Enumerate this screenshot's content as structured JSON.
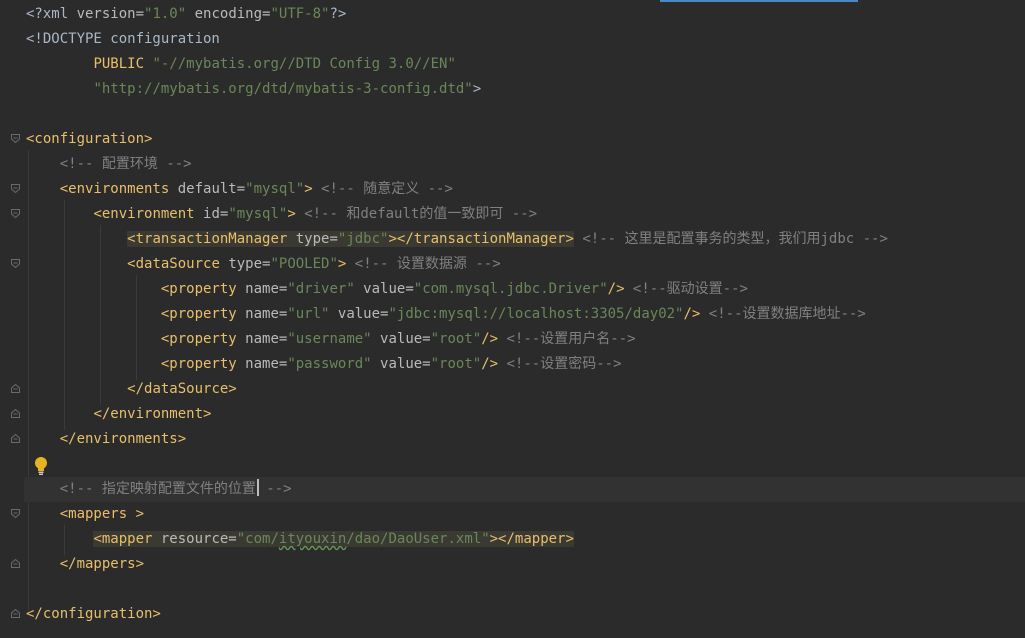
{
  "colors": {
    "background": "#2b2b2b",
    "tag": "#e8bf6a",
    "attribute": "#bababa",
    "value": "#6a8759",
    "comment": "#808080",
    "text": "#a9b7c6"
  },
  "icons": [
    "fold-marker-icon",
    "lightbulb-icon"
  ],
  "code": {
    "xml_decl_open": "<?xml ",
    "xml_decl_version": "version=",
    "xml_decl_version_val": "\"1.0\"",
    "xml_decl_encoding": " encoding=",
    "xml_decl_encoding_val": "\"UTF-8\"",
    "xml_decl_close": "?>",
    "doctype": "<!DOCTYPE configuration",
    "public_kw": "PUBLIC ",
    "public_id": "\"-//mybatis.org//DTD Config 3.0//EN\"",
    "system_id_open": "\"http://mybatis.org/dtd/mybatis-3-config.dtd\"",
    "doctype_close": ">",
    "configuration_open": "<configuration>",
    "comment_env": "<!-- 配置环境 -->",
    "environments_open": "<environments ",
    "attr_default": "default=",
    "val_mysql": "\"mysql\"",
    "gt": ">",
    "comment_define": " <!-- 随意定义 -->",
    "environment_open": "<environment ",
    "attr_id": "id=",
    "comment_same": " <!-- 和default的值一致即可 -->",
    "tm_open": "<transactionManager ",
    "attr_type": "type=",
    "val_jdbc": "\"jdbc\"",
    "tm_close": "></transactionManager>",
    "comment_tm": " <!-- 这里是配置事务的类型，我们用jdbc -->",
    "ds_open": "<dataSource ",
    "val_pooled": "\"POOLED\"",
    "comment_ds": " <!-- 设置数据源 -->",
    "prop_open": "<property ",
    "attr_name": "name=",
    "attr_value": " value=",
    "self_close": "/>",
    "val_driver": "\"driver\"",
    "val_driver_class": "\"com.mysql.jdbc.Driver\"",
    "comment_driver": " <!--驱动设置-->",
    "val_url": "\"url\"",
    "val_url_value": "\"jdbc:mysql://localhost:3305/day02\"",
    "comment_url": " <!--设置数据库地址-->",
    "val_username": "\"username\"",
    "val_root": "\"root\"",
    "comment_username": " <!--设置用户名-->",
    "val_password": "\"password\"",
    "comment_password": " <!--设置密码-->",
    "ds_close": "</dataSource>",
    "environment_close": "</environment>",
    "environments_close": "</environments>",
    "comment_mapper_a": "<!-- 指定映射配置文件的位置",
    "comment_mapper_b": " -->",
    "mappers_open": "<mappers >",
    "mapper_open": "<mapper ",
    "attr_resource": "resource=",
    "val_res_a": "\"com/",
    "val_res_u": "ityouxin",
    "val_res_b": "/dao/DaoUser.xml\"",
    "mapper_close": "></mapper>",
    "mappers_close": "</mappers>",
    "configuration_close": "</configuration>"
  }
}
